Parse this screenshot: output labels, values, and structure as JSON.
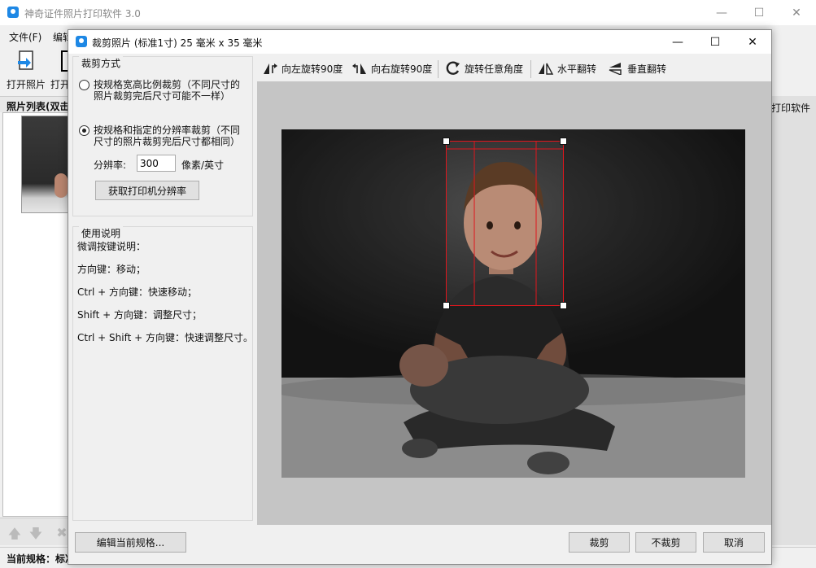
{
  "main_window": {
    "title": "神奇证件照片打印软件 3.0",
    "menu": [
      "文件(F)",
      "编辑"
    ],
    "toolbar": [
      {
        "label": "打开照片",
        "icon": "open-photo-icon"
      },
      {
        "label": "打开",
        "icon": "open-folder-icon"
      }
    ],
    "photo_list_header": "照片列表(双击",
    "right_tab": "打印软件",
    "status_label": "当前规格：标准"
  },
  "dialog": {
    "title": "裁剪照片 (标准1寸) 25 毫米 x 35 毫米",
    "crop_mode": {
      "title": "裁剪方式",
      "option1": "按规格宽高比例裁剪（不同尺寸的照片裁剪完后尺寸可能不一样）",
      "option2": "按规格和指定的分辨率裁剪（不同尺寸的照片裁剪完后尺寸都相同）",
      "selected": 2,
      "resolution_label": "分辨率:",
      "resolution_value": "300",
      "resolution_unit": "像素/英寸",
      "get_printer_resolution": "获取打印机分辨率"
    },
    "instructions": {
      "title": "使用说明",
      "lines": [
        "微调按键说明：",
        "方向键：移动；",
        "Ctrl + 方向键：快速移动；",
        "Shift + 方向键：调整尺寸；",
        "Ctrl + Shift + 方向键：快速调整尺寸。"
      ]
    },
    "toolbar": {
      "rotate_left": "向左旋转90度",
      "rotate_right": "向右旋转90度",
      "rotate_any": "旋转任意角度",
      "flip_h": "水平翻转",
      "flip_v": "垂直翻转"
    },
    "buttons": {
      "edit_spec": "编辑当前规格...",
      "crop": "裁剪",
      "no_crop": "不裁剪",
      "cancel": "取消"
    }
  },
  "colors": {
    "accent": "#1e88e5",
    "crop_line": "#e0161d",
    "canvas_bg": "#c5c5c5"
  }
}
